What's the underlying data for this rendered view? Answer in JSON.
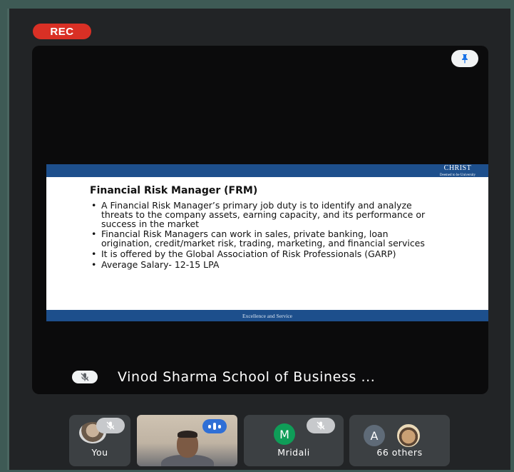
{
  "recording": {
    "label": "REC"
  },
  "stage": {
    "presenter_name": "Vinod Sharma School of Business ...",
    "slide": {
      "brand_line1": "CHRIST",
      "brand_line2": "Deemed to be University",
      "title": "Financial Risk Manager (FRM)",
      "bullets": [
        "A Financial Risk Manager’s primary job duty is to identify and analyze threats to the company assets, earning capacity, and its performance or success in the market",
        "Financial Risk Managers can work in sales, private banking, loan origination, credit/market risk, trading, marketing, and financial services",
        "It is offered by the Global Association of Risk Professionals (GARP)",
        "Average Salary- 12-15 LPA"
      ],
      "footer": "Excellence and Service"
    }
  },
  "participants": [
    {
      "label": "You",
      "muted": true
    },
    {
      "label": "",
      "video": true,
      "speaking": true
    },
    {
      "label": "Mridali",
      "initial": "M",
      "muted": true,
      "avatar_color": "#0f9d58"
    },
    {
      "label": "66 others",
      "initial": "A",
      "avatar_color": "#5f6b78"
    }
  ],
  "icons": {
    "pin": "pin-icon",
    "mic_off": "mic-off-icon",
    "speaking": "audio-level-icon"
  },
  "colors": {
    "rec": "#d93025",
    "slide_band": "#1d4f8c",
    "speaking": "#2f6fd6"
  }
}
